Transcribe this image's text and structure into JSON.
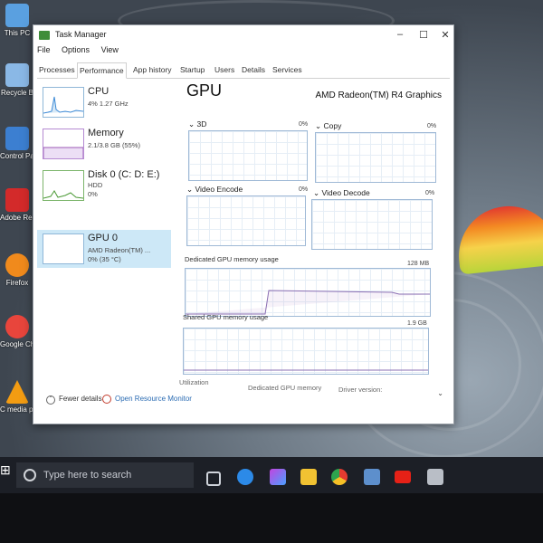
{
  "desktop": {
    "icons": [
      {
        "label": "This PC",
        "color": "#5aa0e0"
      },
      {
        "label": "Recycle B",
        "color": "#8ab8e6"
      },
      {
        "label": "Control Panel",
        "color": "#3c7fd1"
      },
      {
        "label": "Adobe Reader X",
        "color": "#d32a2a"
      },
      {
        "label": "Firefox",
        "color": "#f08a1c"
      },
      {
        "label": "Google Chrome",
        "color": "#e8453c"
      },
      {
        "label": "C media player",
        "color": "#f39c12"
      }
    ]
  },
  "window": {
    "title": "Task Manager",
    "controls": {
      "minimize": "–",
      "maximize": "☐",
      "close": "✕"
    },
    "menu": [
      "File",
      "Options",
      "View"
    ],
    "tabs": [
      {
        "label": "Processes",
        "active": false
      },
      {
        "label": "Performance",
        "active": true
      },
      {
        "label": "App history",
        "active": false
      },
      {
        "label": "Startup",
        "active": false
      },
      {
        "label": "Users",
        "active": false
      },
      {
        "label": "Details",
        "active": false
      },
      {
        "label": "Services",
        "active": false
      }
    ]
  },
  "sidebar": {
    "items": [
      {
        "name": "CPU",
        "sub1": "4%  1.27 GHz",
        "sub2": "",
        "sub3": ""
      },
      {
        "name": "Memory",
        "sub1": "2.1/3.8 GB (55%)",
        "sub2": "",
        "sub3": ""
      },
      {
        "name": "Disk 0 (C: D: E:)",
        "sub1": "HDD",
        "sub2": "0%",
        "sub3": ""
      },
      {
        "name": "GPU 0",
        "sub1": "AMD Radeon(TM) ...",
        "sub2": "0% (35 °C)",
        "sub3": ""
      }
    ]
  },
  "main": {
    "title": "GPU",
    "model": "AMD Radeon(TM) R4 Graphics",
    "engines": [
      {
        "label": "3D",
        "pct": "0%"
      },
      {
        "label": "Copy",
        "pct": "0%"
      },
      {
        "label": "Video Encode",
        "pct": "0%"
      },
      {
        "label": "Video Decode",
        "pct": "0%"
      }
    ],
    "dedicated": {
      "label": "Dedicated GPU memory usage",
      "max": "128 MB"
    },
    "shared": {
      "label": "Shared GPU memory usage",
      "max": "1.9 GB"
    },
    "stats": {
      "utilization": "Utilization",
      "dedicated_memory": "Dedicated GPU memory",
      "driver_version": "Driver version:"
    }
  },
  "footer": {
    "fewer_details": "Fewer details",
    "open_resource_monitor": "Open Resource Monitor"
  },
  "taskbar": {
    "search_placeholder": "Type here to search"
  }
}
